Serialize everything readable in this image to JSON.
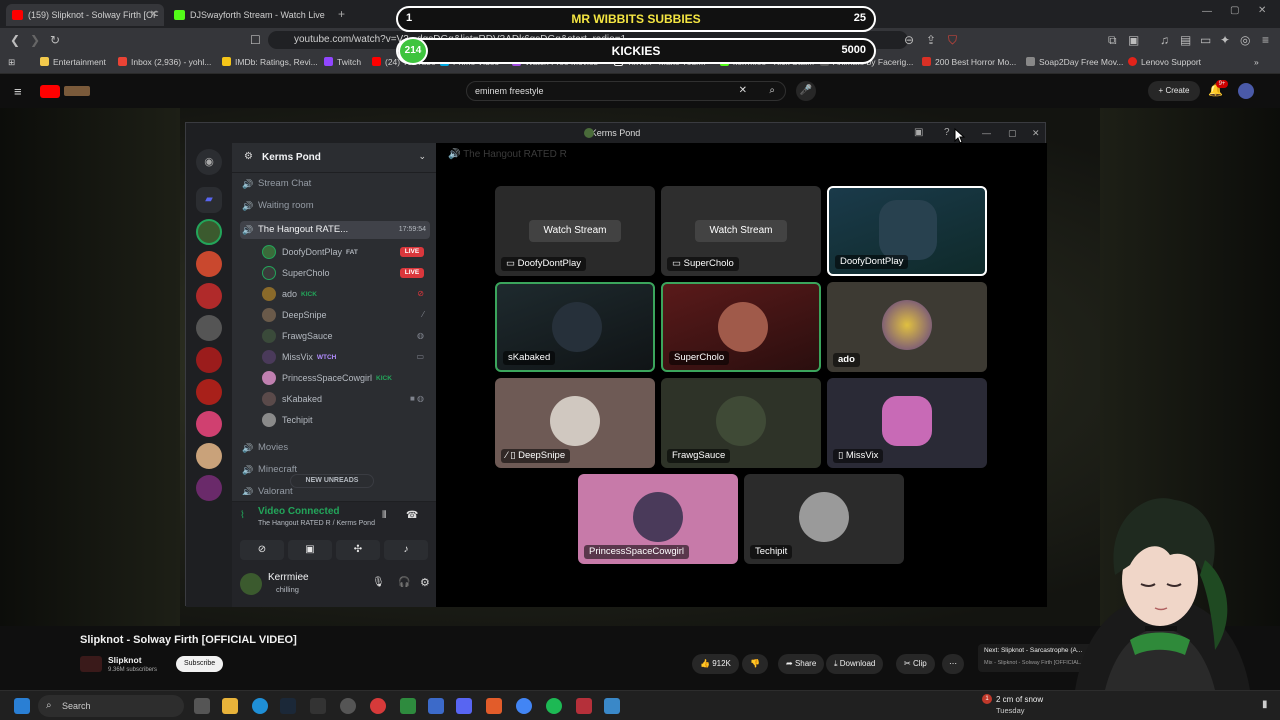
{
  "browser": {
    "tabs": [
      {
        "title": "(159) Slipknot - Solway Firth [OF",
        "active": true
      },
      {
        "title": "DJSwayforth Stream - Watch Live",
        "active": false
      }
    ],
    "url": "youtube.com/watch?v=V3...dgsDGg&list=RDV3ADk6gsDGg&start_radio=1",
    "bookmarks": [
      "Entertainment",
      "Inbox (2,936) - yohl...",
      "IMDb: Ratings, Revi...",
      "Twitch",
      "(24) YouTube",
      "Prime Video",
      "Watch Free Movies",
      "TikTok - Make Your...",
      "kerrmiee - Kick Stat...",
      "Animate by Facerig...",
      "200 Best Horror Mo...",
      "Soap2Day Free Mov...",
      "Lenovo Support"
    ]
  },
  "overlays": {
    "sub_goal": {
      "left": "1",
      "title": "MR WIBBITS SUBBIES",
      "right": "25"
    },
    "kick_goal": {
      "badge": "214",
      "title": "KICKIES",
      "right": "5000"
    }
  },
  "youtube": {
    "search_value": "eminem freestyle",
    "create_label": "Create",
    "notif_count": "9+",
    "video_title": "Slipknot - Solway Firth [OFFICIAL VIDEO]",
    "channel": "Slipknot",
    "subscribers": "9.36M subscribers",
    "subscribe_label": "Subscribe",
    "likes": "912K",
    "share_label": "Share",
    "download_label": "Download",
    "clip_label": "Clip",
    "next_label": "Next: Slipknot - Sarcastrophe (A...",
    "mix_label": "Mix - Slipknot - Solway Firth [OFFICIAL..."
  },
  "discord": {
    "window_title": "Kerms Pond",
    "server_name": "Kerms Pond",
    "stage_channel": "The Hangout RATED R",
    "channels": [
      {
        "name": "Stream Chat",
        "icon": "🔊"
      },
      {
        "name": "Waiting room",
        "icon": "🔊"
      },
      {
        "name": "The Hangout RATE...",
        "icon": "🔊",
        "timer": "17:59:54"
      }
    ],
    "users": [
      {
        "name": "DoofyDontPlay",
        "tag": "FAT",
        "live": "LIVE"
      },
      {
        "name": "SuperCholo",
        "tag": "",
        "live": "LIVE"
      },
      {
        "name": "ado",
        "tag": "KICK",
        "live": ""
      },
      {
        "name": "DeepSnipe",
        "tag": "",
        "live": ""
      },
      {
        "name": "FrawgSauce",
        "tag": "",
        "live": ""
      },
      {
        "name": "MissVix",
        "tag": "WTCH",
        "live": ""
      },
      {
        "name": "PrincessSpaceCowgirl",
        "tag": "KICK",
        "live": ""
      },
      {
        "name": "sKabaked",
        "tag": "",
        "live": ""
      },
      {
        "name": "Techipit",
        "tag": "",
        "live": ""
      }
    ],
    "more_channels": [
      {
        "name": "Movies"
      },
      {
        "name": "Minecraft"
      },
      {
        "name": "Valorant"
      }
    ],
    "new_unreads": "NEW UNREADS",
    "voice_status": "Video Connected",
    "voice_location": "The Hangout RATED R / Kerms Pond",
    "self_name": "Kerrmiee",
    "self_status": "chilling",
    "tiles": [
      {
        "name": "DoofyDontPlay",
        "watch": "Watch Stream"
      },
      {
        "name": "SuperCholo",
        "watch": "Watch Stream"
      },
      {
        "name": "DoofyDontPlay",
        "watch": ""
      },
      {
        "name": "sKabaked",
        "watch": ""
      },
      {
        "name": "SuperCholo",
        "watch": ""
      },
      {
        "name": "ado",
        "watch": ""
      },
      {
        "name": "DeepSnipe",
        "watch": ""
      },
      {
        "name": "FrawgSauce",
        "watch": ""
      },
      {
        "name": "MissVix",
        "watch": ""
      },
      {
        "name": "PrincessSpaceCowgirl",
        "watch": ""
      },
      {
        "name": "Techipit",
        "watch": ""
      }
    ]
  },
  "taskbar": {
    "search_placeholder": "Search",
    "weather": "2 cm of snow",
    "day": "Tuesday",
    "weather_badge": "1"
  },
  "colors": {
    "discord_green": "#23a55a",
    "live_red": "#da373c",
    "kick_green": "#3ec43e",
    "sub_text_yellow": "#f5e642",
    "kick_text": "#ffffff",
    "speaking_outline": "#3ba55c"
  }
}
